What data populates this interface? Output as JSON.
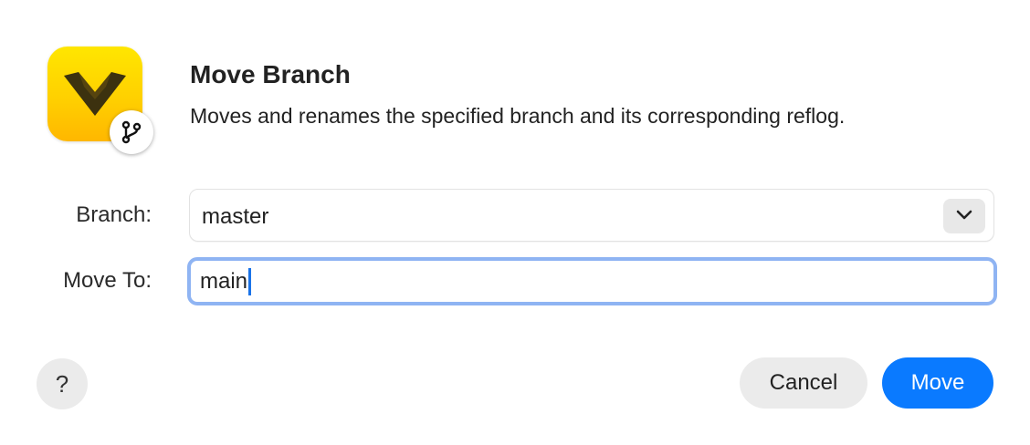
{
  "dialog": {
    "title": "Move Branch",
    "description": "Moves and renames the specified branch and its corresponding reflog."
  },
  "app_icon": {
    "name": "app-logo-icon",
    "badge_icon": "git-branch-icon",
    "colors": [
      "#ffe600",
      "#ffb700"
    ]
  },
  "form": {
    "branch": {
      "label": "Branch:",
      "value": "master",
      "dropdown_icon": "chevron-down-icon"
    },
    "move_to": {
      "label": "Move To:",
      "value": "main"
    }
  },
  "buttons": {
    "help": "?",
    "cancel": "Cancel",
    "move": "Move"
  },
  "colors": {
    "accent": "#0a7aff",
    "focus_ring": "#8fb4f3",
    "button_gray": "#ebebeb"
  }
}
